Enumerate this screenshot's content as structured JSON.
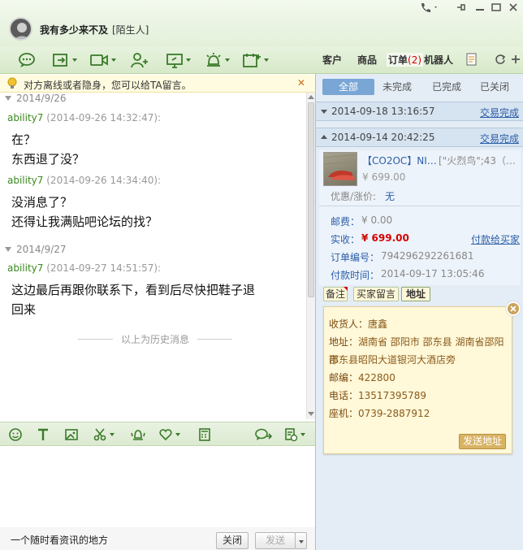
{
  "header": {
    "contact_name": "我有多少来不及",
    "contact_tag": "[陌生人]"
  },
  "right_tabs": {
    "customer": "客户",
    "product": "商品",
    "order": "订单",
    "order_count": "(2)",
    "robot": "机器人"
  },
  "notice": {
    "text": "对方离线或者隐身，您可以给TA留言。",
    "close": "✕"
  },
  "chat": {
    "days": [
      {
        "date": "2014/9/26"
      },
      {
        "date": "2014/9/27"
      }
    ],
    "messages": [
      {
        "sender": "ability7",
        "time": "(2014-09-26 14:32:47):",
        "line1": "在？",
        "line2": "东西退了没？"
      },
      {
        "sender": "ability7",
        "time": "(2014-09-26 14:34:40):",
        "line1": "没消息了？",
        "line2": "还得让我满贴吧论坛的找？"
      },
      {
        "sender": "ability7",
        "time": "(2014-09-27 14:51:57):",
        "line1": "这边最后再跟你联系下，看到后尽快把鞋子退",
        "line2": "回来"
      }
    ],
    "history_divider": "以上为历史消息"
  },
  "footer": {
    "hint": "一个随时看资讯的地方",
    "close_label": "关闭",
    "send_label": "发送"
  },
  "filters": {
    "all": "全部",
    "incomplete": "未完成",
    "complete": "已完成",
    "closed": "已关闭"
  },
  "orders": [
    {
      "datetime": "2014-09-18 13:16:57",
      "status": "交易完成"
    },
    {
      "datetime": "2014-09-14 20:42:25",
      "status": "交易完成",
      "product_title": "【CO2OC】NI…",
      "product_sku": "[\"火烈鸟\";43（…",
      "product_price": "¥ 699.00",
      "discount_label": "优惠/涨价:",
      "discount_value": "无",
      "shipping_label": "邮费：",
      "shipping_value": "¥ 0.00",
      "paid_label": "实收：",
      "paid_value": "¥ 699.00",
      "pay_link": "付款给买家",
      "order_no_label": "订单编号：",
      "order_no": "794296292261681",
      "pay_time_label": "付款时间：",
      "pay_time": "2014-09-17 13:05:46"
    }
  ],
  "order_actions": {
    "note": "备注",
    "message": "买家留言",
    "address": "地址"
  },
  "address": {
    "receiver_label": "收货人：",
    "receiver": "唐鑫",
    "addr_label": "地址：",
    "addr_line1": "湖南省 邵阳市 邵东县 湖南省邵阳市",
    "addr_line2": "邵东县昭阳大道银河大酒店旁",
    "zip_label": "邮编：",
    "zip": "422800",
    "phone_label": "电话：",
    "phone": "13517395789",
    "tel_label": "座机：",
    "tel": "0739-2887912",
    "send_button": "发送地址"
  },
  "colors": {
    "accent_green": "#3a7a2a",
    "link_blue": "#2b5ea8",
    "price_red": "#d40000"
  }
}
